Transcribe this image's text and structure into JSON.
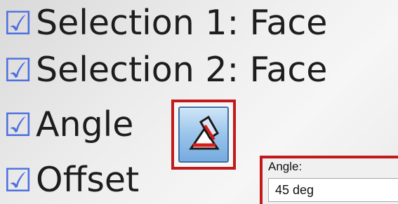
{
  "bullets": [
    {
      "icon": "check-box-icon",
      "text": "Selection 1: Face"
    },
    {
      "icon": "check-box-icon",
      "text": "Selection 2: Face"
    },
    {
      "icon": "check-box-icon",
      "text": "Angle"
    },
    {
      "icon": "check-box-icon",
      "text": "Offset"
    }
  ],
  "check_glyph": "☑",
  "angle_tool": {
    "icon": "angle-mate-icon",
    "highlight_color": "#c21a1a"
  },
  "angle_panel": {
    "label": "Angle:",
    "value": "45 deg"
  },
  "colors": {
    "bullet_icon": "#4c6fe0",
    "text": "#1d1d1d",
    "highlight": "#c21a1a"
  }
}
